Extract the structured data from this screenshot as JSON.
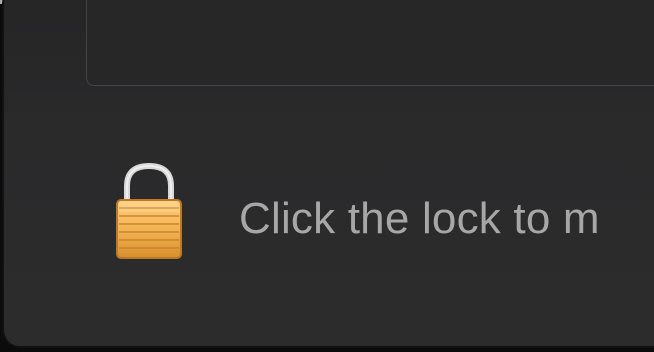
{
  "lock": {
    "icon": "lock-icon",
    "message": "Click the lock to m"
  },
  "colors": {
    "window_bg": "#2a2a2b",
    "text": "#a7a7a7",
    "lock_gold": "#f2b14f"
  }
}
